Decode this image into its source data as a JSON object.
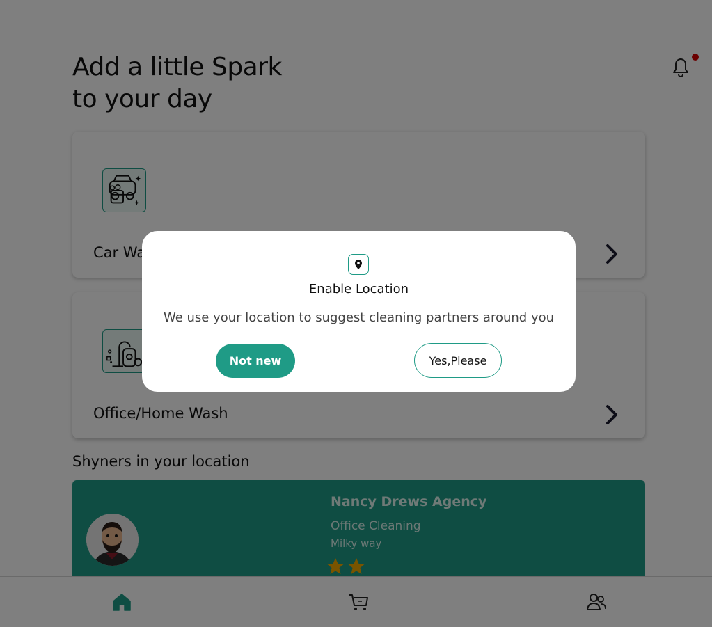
{
  "header": {
    "headline_line1": "Add a little Spark",
    "headline_line2": "to your day",
    "notification_icon": "bell-icon"
  },
  "services": [
    {
      "label": "Car Wash",
      "icon": "car-wash-icon"
    },
    {
      "label": "Office/Home Wash",
      "icon": "vacuum-cleaner-icon"
    }
  ],
  "section": {
    "title": "Shyners in your location"
  },
  "partner": {
    "name": "Nancy Drews Agency",
    "service": "Office Cleaning",
    "location": "Milky way",
    "rating": 2,
    "rating_max": 5
  },
  "bottom_nav": {
    "items": [
      {
        "icon": "home-icon",
        "active": true
      },
      {
        "icon": "cart-icon",
        "active": false
      },
      {
        "icon": "people-icon",
        "active": false
      }
    ]
  },
  "modal": {
    "title": "Enable Location",
    "message": "We use your location to suggest cleaning partners around you",
    "decline_label": "Not new",
    "accept_label": "Yes,Please",
    "icon": "location-pin-icon"
  },
  "colors": {
    "accent": "#1f9b86",
    "notification_dot": "#d60000",
    "star_filled": "#f2a900"
  }
}
